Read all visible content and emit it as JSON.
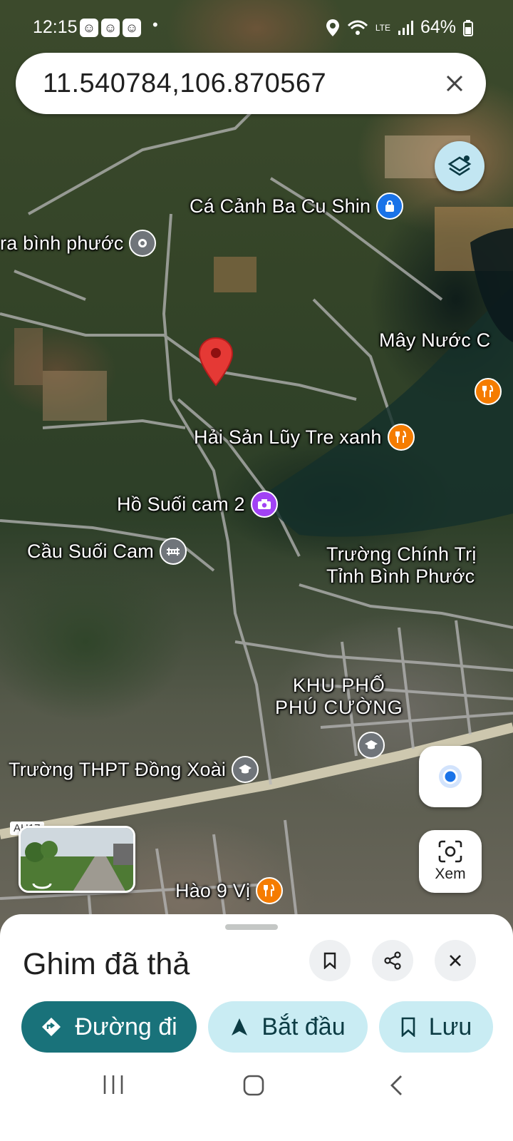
{
  "status_bar": {
    "time": "12:15",
    "battery": "64%",
    "network": "LTE"
  },
  "search": {
    "query": "11.540784,106.870567"
  },
  "map": {
    "places": [
      {
        "label": "Cá Cảnh Ba Cu Shin",
        "icon": "shopping-bag-icon",
        "color": "#1a73e8"
      },
      {
        "label": "ra bình phước",
        "icon": "place-icon",
        "color": "#70757a"
      },
      {
        "label": "Mây Nước C",
        "icon": "",
        "color": ""
      },
      {
        "label": "Hải Sản Lũy Tre xanh",
        "icon": "fork-knife-icon",
        "color": "#f57c00"
      },
      {
        "label": "Hồ Suối cam 2",
        "icon": "camera-icon",
        "color": "#a142f4"
      },
      {
        "label": "Cầu Suối Cam",
        "icon": "bridge-icon",
        "color": "#70757a"
      },
      {
        "label": "Trường Chính Trị",
        "icon": "",
        "color": ""
      },
      {
        "label": "Tỉnh Bình Phước",
        "icon": "",
        "color": ""
      },
      {
        "label": "KHU PHỐ",
        "icon": "",
        "color": ""
      },
      {
        "label": "PHÚ CƯỜNG",
        "icon": "",
        "color": ""
      },
      {
        "label": "Trường THPT Đồng Xoài",
        "icon": "graduation-cap-icon",
        "color": "#70757a"
      },
      {
        "label": "Hào 9 Vị",
        "icon": "fork-knife-icon",
        "color": "#f57c00"
      }
    ],
    "road_shield": "AH17",
    "lens_label": "Xem"
  },
  "sheet": {
    "title": "Ghim đã thả",
    "directions_label": "Đường đi",
    "start_label": "Bắt đầu",
    "save_label": "Lưu"
  },
  "colors": {
    "accent": "#19727a",
    "tonal": "#c9ecf3",
    "pin_red": "#e53935"
  }
}
